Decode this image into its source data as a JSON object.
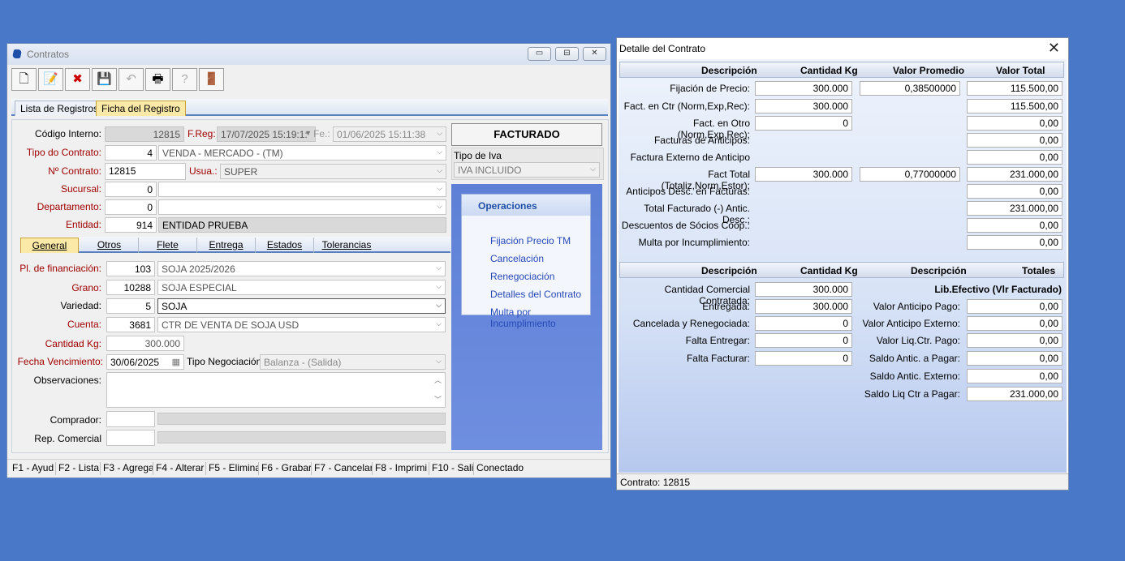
{
  "contratos": {
    "title": "Contratos",
    "window_buttons": [
      "▭",
      "⊟",
      "✕"
    ],
    "tabs": [
      "Lista de Registros",
      "Ficha del Registro"
    ],
    "header": {
      "codigo_label": "Código Interno:",
      "codigo_value": "12815",
      "freg_label": "F.Reg:",
      "freg_value": "17/07/2025 15:19:1:",
      "fe_label": "Fe.:",
      "fe_value": "01/06/2025 15:11:38",
      "tipo_contrato_label": "Tipo do Contrato:",
      "tipo_contrato_code": "4",
      "tipo_contrato_value": "VENDA - MERCADO - (TM)",
      "nro_contrato_label": "Nº Contrato:",
      "nro_contrato_value": "12815",
      "usua_label": "Usua.:",
      "usua_value": "SUPER",
      "sucursal_label": "Sucursal:",
      "sucursal_code": "0",
      "departamento_label": "Departamento:",
      "departamento_code": "0",
      "entidad_label": "Entidad:",
      "entidad_code": "914",
      "entidad_value": "ENTIDAD PRUEBA"
    },
    "facturado": "FACTURADO",
    "tipo_iva_label": "Tipo de Iva",
    "tipo_iva_value": "IVA INCLUIDO",
    "sub_tabs": [
      "General",
      "Otros",
      "Flete",
      "Entrega",
      "Estados",
      "Tolerancias"
    ],
    "general": {
      "financiacion_label": "Pl. de financiación:",
      "financiacion_code": "103",
      "financiacion_value": "SOJA 2025/2026",
      "grano_label": "Grano:",
      "grano_code": "10288",
      "grano_value": "SOJA ESPECIAL",
      "variedad_label": "Variedad:",
      "variedad_code": "5",
      "variedad_value": "SOJA",
      "cuenta_label": "Cuenta:",
      "cuenta_code": "3681",
      "cuenta_value": "CTR DE VENTA DE SOJA USD",
      "cantidad_label": "Cantidad Kg:",
      "cantidad_value": "300.000",
      "vencimiento_label": "Fecha Vencimiento:",
      "vencimiento_value": "30/06/2025",
      "tipo_neg_label": "Tipo Negociación:",
      "tipo_neg_value": "Balanza - (Salida)",
      "observaciones_label": "Observaciones:",
      "comprador_label": "Comprador:",
      "rep_label": "Rep. Comercial"
    },
    "operaciones": {
      "title": "Operaciones",
      "items": [
        "Fijación Precio TM",
        "Cancelación",
        "Renegociación",
        "Detalles del Contrato",
        "Multa por Incumplimiento"
      ]
    },
    "statusbar": [
      "F1 - Ayud",
      "F2 - Lista",
      "F3 - Agrega",
      "F4 - Alterar",
      "F5 - Elimina",
      "F6 - Grabar",
      "F7 - Cancelar",
      "F8 - Imprimi",
      "F10 - Salir",
      "Conectado"
    ]
  },
  "detalle": {
    "title": "Detalle del Contrato",
    "head1": [
      "Descripción",
      "Cantidad Kg",
      "Valor Promedio",
      "Valor Total"
    ],
    "rows1": [
      {
        "label": "Fijación de Precio:",
        "cantidad": "300.000",
        "promedio": "0,38500000",
        "total": "115.500,00"
      },
      {
        "label": "Fact. en Ctr (Norm,Exp,Rec):",
        "cantidad": "300.000",
        "promedio": "",
        "total": "115.500,00"
      },
      {
        "label": "Fact. en Otro (Norm,Exp,Rec):",
        "cantidad": "0",
        "promedio": "",
        "total": "0,00"
      },
      {
        "label": "Facturas de Anticipos:",
        "cantidad": "",
        "promedio": "",
        "total": "0,00"
      },
      {
        "label": "Factura Externo de Anticipo",
        "cantidad": "",
        "promedio": "",
        "total": "0,00"
      },
      {
        "label": "Fact Total (Totaliz,Norm,Estor):",
        "cantidad": "300.000",
        "promedio": "0,77000000",
        "total": "231.000,00"
      },
      {
        "label": "Anticipos Desc. en Facturas:",
        "cantidad": "",
        "promedio": "",
        "total": "0,00"
      },
      {
        "label": "Total Facturado (-) Antic. Desc.:",
        "cantidad": "",
        "promedio": "",
        "total": "231.000,00"
      },
      {
        "label": "Descuentos de Sócios Coop.:",
        "cantidad": "",
        "promedio": "",
        "total": "0,00"
      },
      {
        "label": "Multa por Incumplimiento:",
        "cantidad": "",
        "promedio": "",
        "total": "0,00"
      }
    ],
    "head2": [
      "Descripción",
      "Cantidad Kg",
      "Descripción",
      "Totales"
    ],
    "lib_efectivo": "Lib.Efectivo (Vlr Facturado)",
    "rows2_left": [
      {
        "label": "Cantidad Comercial Contratada:",
        "value": "300.000"
      },
      {
        "label": "Entregada:",
        "value": "300.000"
      },
      {
        "label": "Cancelada y Renegociada:",
        "value": "0"
      },
      {
        "label": "Falta Entregar:",
        "value": "0"
      },
      {
        "label": "Falta Facturar:",
        "value": "0"
      }
    ],
    "rows2_right": [
      {
        "label": "Valor Anticipo Pago:",
        "value": "0,00"
      },
      {
        "label": "Valor Anticipo Externo:",
        "value": "0,00"
      },
      {
        "label": "Valor Liq.Ctr. Pago:",
        "value": "0,00"
      },
      {
        "label": "Saldo Antic. a Pagar:",
        "value": "0,00"
      },
      {
        "label": "Saldo Antic. Externo:",
        "value": "0,00"
      },
      {
        "label": "Saldo Liq Ctr a Pagar:",
        "value": "231.000,00"
      }
    ],
    "footer": "Contrato: 12815"
  }
}
